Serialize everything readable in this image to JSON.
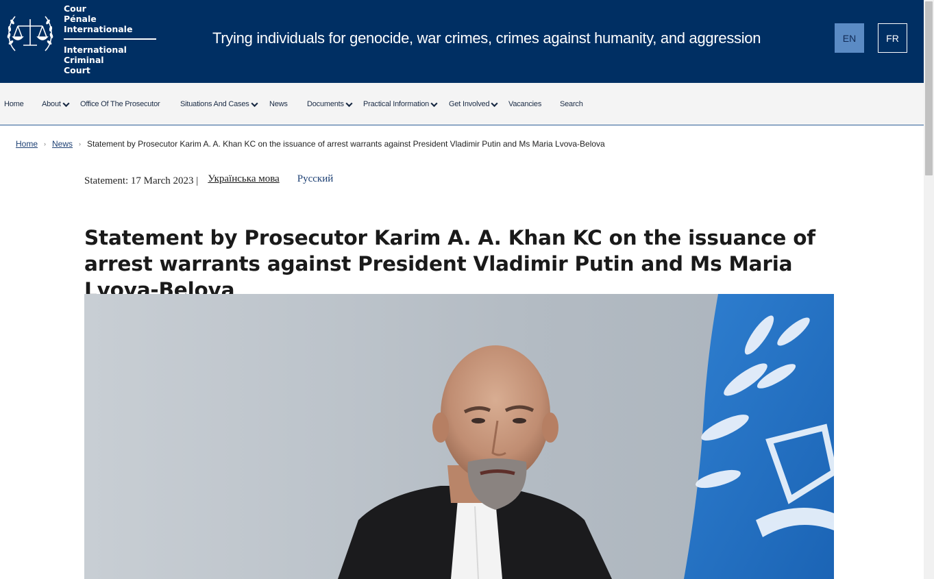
{
  "header": {
    "org_lines_fr": [
      "Cour",
      "Pénale",
      "Internationale"
    ],
    "org_lines_en": [
      "International",
      "Criminal",
      "Court"
    ],
    "tagline": "Trying individuals for genocide, war crimes, crimes against humanity, and aggression",
    "logo_icon": "icc-scales-laurel-icon",
    "lang_en": "EN",
    "lang_fr": "FR",
    "colors": {
      "header_bg": "#002f63",
      "active_lang_bg": "#5b8bc4"
    }
  },
  "nav": {
    "items": [
      {
        "label": "Home",
        "has_dropdown": false
      },
      {
        "label": "About",
        "has_dropdown": true
      },
      {
        "label": "Office Of The Prosecutor",
        "has_dropdown": false
      },
      {
        "label": "Situations And Cases",
        "has_dropdown": true
      },
      {
        "label": "News",
        "has_dropdown": false
      },
      {
        "label": "Documents",
        "has_dropdown": true
      },
      {
        "label": "Practical Information",
        "has_dropdown": true
      },
      {
        "label": "Get Involved",
        "has_dropdown": true
      },
      {
        "label": "Vacancies",
        "has_dropdown": false
      },
      {
        "label": "Search",
        "has_dropdown": false
      }
    ]
  },
  "breadcrumb": {
    "home": "Home",
    "news": "News",
    "current": "Statement by Prosecutor Karim A. A. Khan KC on the issuance of arrest warrants against President Vladimir Putin and Ms Maria Lvova-Belova",
    "separator": "›"
  },
  "article": {
    "meta_date": "Statement: 17 March 2023 |",
    "lang_ukrainian": "Українська мова",
    "lang_russian": "Русский",
    "title": "Statement by Prosecutor Karim A. A. Khan KC on the issuance of arrest warrants against President Vladimir Putin and Ms Maria Lvova-Belova",
    "photo_icon": "prosecutor-portrait-image"
  }
}
